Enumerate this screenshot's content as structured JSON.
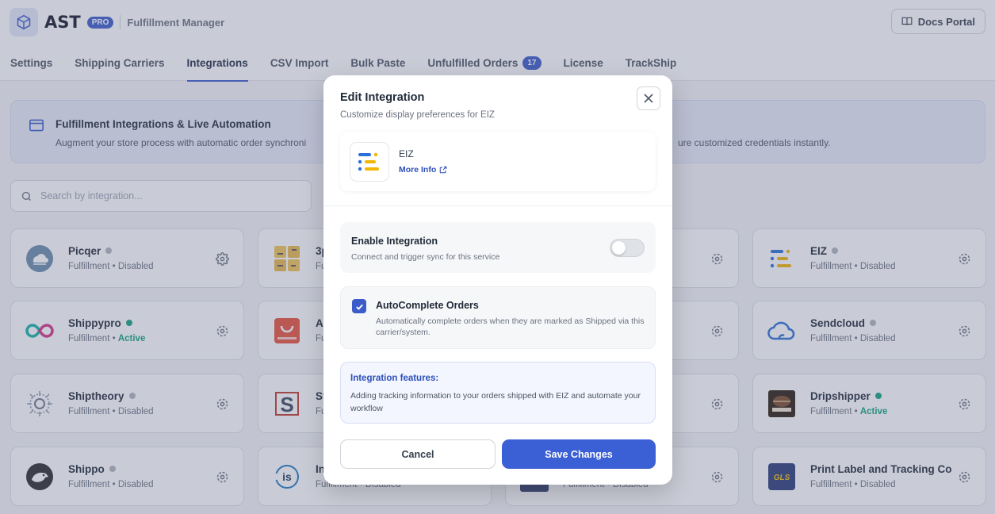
{
  "header": {
    "brand": "AST",
    "pro_badge": "PRO",
    "subtitle": "Fulfillment Manager",
    "docs_label": "Docs Portal"
  },
  "tabs": [
    {
      "label": "Settings"
    },
    {
      "label": "Shipping Carriers"
    },
    {
      "label": "Integrations",
      "active": true
    },
    {
      "label": "CSV Import"
    },
    {
      "label": "Bulk Paste"
    },
    {
      "label": "Unfulfilled Orders",
      "badge": "17"
    },
    {
      "label": "License"
    },
    {
      "label": "TrackShip"
    }
  ],
  "banner": {
    "title": "Fulfillment Integrations & Live Automation",
    "text_left": "Augment your store process with automatic order synchroni",
    "text_right": "ure customized credentials instantly."
  },
  "search": {
    "placeholder": "Search by integration..."
  },
  "cards": [
    {
      "name": "Picqer",
      "category": "Fulfillment",
      "status": "Disabled",
      "icon": "picqer-logo"
    },
    {
      "name": "3p",
      "category": "Ful",
      "status": "",
      "icon": "3pl-logo"
    },
    {
      "name": "EIZ",
      "category": "Fulfillment",
      "status": "Disabled",
      "icon": "eiz-logo"
    },
    {
      "name": "Shippypro",
      "category": "Fulfillment",
      "status": "Active",
      "icon": "shippypro-logo"
    },
    {
      "name": "Al",
      "category": "Fu",
      "status": "",
      "icon": "aliexpress-logo"
    },
    {
      "name": "Sendcloud",
      "category": "Fulfillment",
      "status": "Disabled",
      "icon": "sendcloud-logo"
    },
    {
      "name": "Shiptheory",
      "category": "Fulfillment",
      "status": "Disabled",
      "icon": "shiptheory-logo"
    },
    {
      "name": "St",
      "category": "Fu",
      "status": "",
      "icon": "s-logo"
    },
    {
      "name": "Dripshipper",
      "category": "Fulfillment",
      "status": "Active",
      "icon": "dripshipper-logo"
    },
    {
      "name": "Shippo",
      "category": "Fulfillment",
      "status": "Disabled",
      "icon": "shippo-logo"
    },
    {
      "name": "In",
      "category": "Fulfillment",
      "status": "Disabled",
      "icon": "is-logo"
    },
    {
      "name": "",
      "category": "Fulfillment",
      "status": "Disabled",
      "icon": "partial-logo"
    },
    {
      "name": "Print Label and Tracking Co",
      "category": "Fulfillment",
      "status": "Disabled",
      "icon": "gls-logo"
    }
  ],
  "modal": {
    "title": "Edit Integration",
    "subtitle": "Customize display preferences for EIZ",
    "integration_name": "EIZ",
    "more_info": "More Info",
    "enable_title": "Enable Integration",
    "enable_desc": "Connect and trigger sync for this service",
    "enabled": false,
    "autocomplete_title": "AutoComplete Orders",
    "autocomplete_desc": "Automatically complete orders when they are marked as Shipped via this carrier/system.",
    "autocomplete_checked": true,
    "features_title": "Integration features:",
    "features_desc": "Adding tracking information to your orders shipped with EIZ and automate your workflow",
    "cancel_label": "Cancel",
    "save_label": "Save Changes"
  },
  "colors": {
    "accent": "#3b5cc9",
    "active_status": "#10a37f"
  }
}
